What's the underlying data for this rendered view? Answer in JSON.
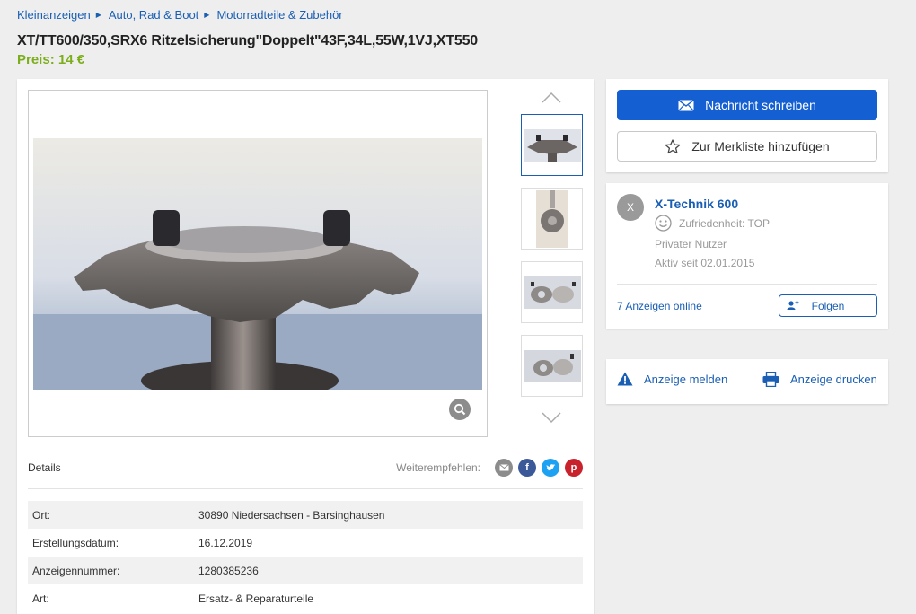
{
  "breadcrumb": {
    "items": [
      "Kleinanzeigen",
      "Auto, Rad & Boot",
      "Motorradteile & Zubehör"
    ]
  },
  "listing": {
    "title": "XT/TT600/350,SRX6 Ritzelsicherung\"Doppelt\"43F,34L,55W,1VJ,XT550",
    "price": "Preis: 14 €"
  },
  "gallery": {
    "main_image": "sprocket-closeup-photo",
    "thumbnails": [
      "sprocket-closeup",
      "sprocket-vertical",
      "locking-plates-1",
      "locking-plates-2"
    ],
    "active_index": 0
  },
  "details": {
    "label": "Details",
    "share_label": "Weiterempfehlen:",
    "share_icons": [
      "email-icon",
      "facebook-icon",
      "twitter-icon",
      "pinterest-icon"
    ],
    "rows": [
      {
        "key": "Ort:",
        "value": "30890 Niedersachsen - Barsinghausen"
      },
      {
        "key": "Erstellungsdatum:",
        "value": "16.12.2019"
      },
      {
        "key": "Anzeigennummer:",
        "value": "1280385236"
      },
      {
        "key": "Art:",
        "value": "Ersatz- & Reparaturteile"
      }
    ]
  },
  "contact": {
    "message_button": "Nachricht schreiben",
    "watchlist_button": "Zur Merkliste hinzufügen"
  },
  "seller": {
    "avatar_letter": "X",
    "name": "X-Technik 600",
    "satisfaction": "Zufriedenheit: TOP",
    "type": "Privater Nutzer",
    "active_since": "Aktiv seit 02.01.2015",
    "ads_online": "7 Anzeigen online",
    "follow_button": "Folgen"
  },
  "actions": {
    "report": "Anzeige melden",
    "print": "Anzeige drucken"
  },
  "colors": {
    "link": "#1a5fb4",
    "primary_button": "#1460d3",
    "price": "#7cae1c"
  }
}
